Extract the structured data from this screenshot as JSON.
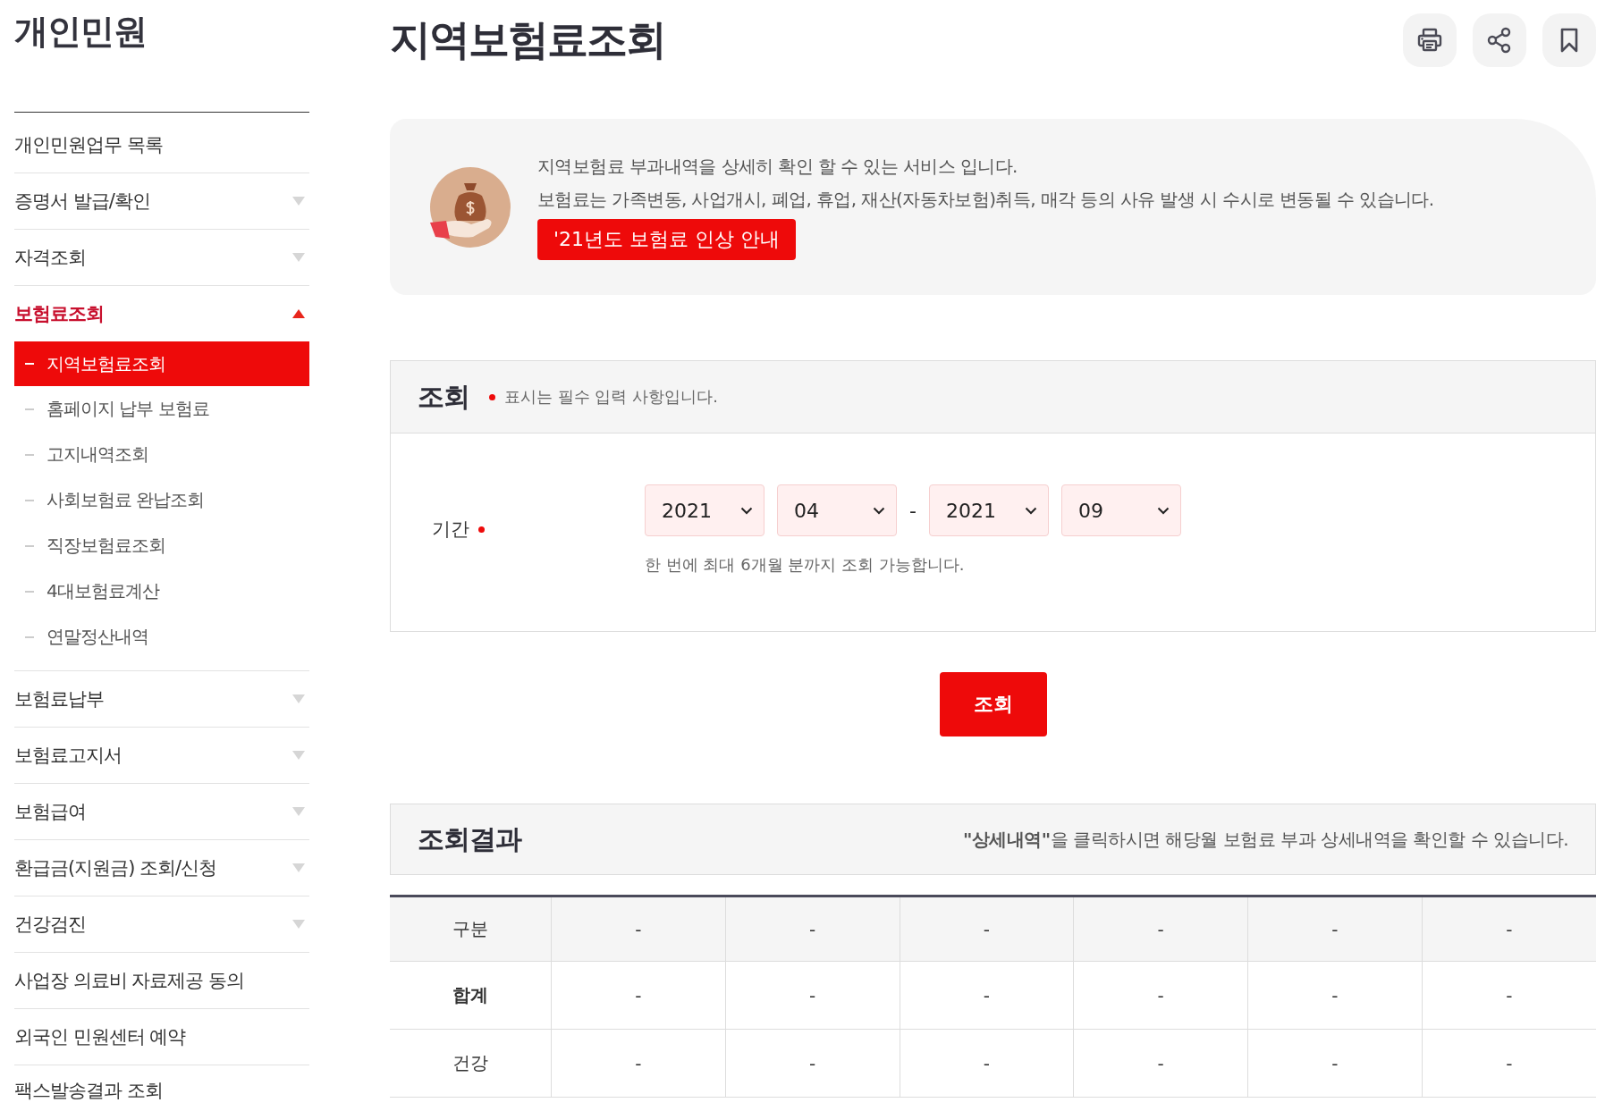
{
  "sidebar": {
    "title": "개인민원",
    "items": [
      {
        "label": "개인민원업무 목록",
        "kind": "link"
      },
      {
        "label": "증명서 발급/확인",
        "kind": "group",
        "expanded": false
      },
      {
        "label": "자격조회",
        "kind": "group",
        "expanded": false
      },
      {
        "label": "보험료조회",
        "kind": "group",
        "expanded": true,
        "children": [
          {
            "label": "지역보험료조회",
            "selected": true
          },
          {
            "label": "홈페이지 납부 보험료",
            "selected": false
          },
          {
            "label": "고지내역조회",
            "selected": false
          },
          {
            "label": "사회보험료 완납조회",
            "selected": false
          },
          {
            "label": "직장보험료조회",
            "selected": false
          },
          {
            "label": "4대보험료계산",
            "selected": false
          },
          {
            "label": "연말정산내역",
            "selected": false
          }
        ]
      },
      {
        "label": "보험료납부",
        "kind": "group",
        "expanded": false
      },
      {
        "label": "보험료고지서",
        "kind": "group",
        "expanded": false
      },
      {
        "label": "보험급여",
        "kind": "group",
        "expanded": false
      },
      {
        "label": "환급금(지원금) 조회/신청",
        "kind": "group",
        "expanded": false
      },
      {
        "label": "건강검진",
        "kind": "group",
        "expanded": false
      },
      {
        "label": "사업장 의료비 자료제공 동의",
        "kind": "link"
      },
      {
        "label": "외국인 민원센터 예약",
        "kind": "link"
      },
      {
        "label": "팩스발송결과 조회",
        "kind": "link"
      }
    ]
  },
  "header": {
    "title": "지역보험료조회",
    "actions": [
      {
        "kind": "print"
      },
      {
        "kind": "share"
      },
      {
        "kind": "bookmark"
      }
    ]
  },
  "notice": {
    "lines": [
      "지역보험료 부과내역을 상세히 확인 할 수 있는 서비스 입니다.",
      "보험료는 가족변동, 사업개시, 폐업, 휴업, 재산(자동차보험)취득, 매각 등의 사유 발생 시 수시로 변동될 수 있습니다."
    ],
    "button": "'21년도 보험료 인상 안내"
  },
  "query": {
    "title": "조회",
    "required_note": "표시는 필수 입력 사항입니다.",
    "period": {
      "label": "기간",
      "required": true,
      "from": [
        "2021",
        "04"
      ],
      "separator": "-",
      "to": [
        "2021",
        "09"
      ],
      "hint": "한 번에 최대 6개월 분까지 조회 가능합니다."
    },
    "submit": "조회"
  },
  "results": {
    "title": "조회결과",
    "note": "**\"상세내역\"**을 클릭하시면 해당월 보험료 부과 상세내역을 확인할 수 있습니다.",
    "rows": [
      {
        "kind": "header",
        "cells": [
          "구분",
          "-",
          "-",
          "-",
          "-",
          "-",
          "-"
        ]
      },
      {
        "kind": "total",
        "cells": [
          "합계",
          "-",
          "-",
          "-",
          "-",
          "-",
          "-"
        ]
      },
      {
        "kind": "normal",
        "cells": [
          "건강",
          "-",
          "-",
          "-",
          "-",
          "-",
          "-"
        ]
      }
    ]
  }
}
